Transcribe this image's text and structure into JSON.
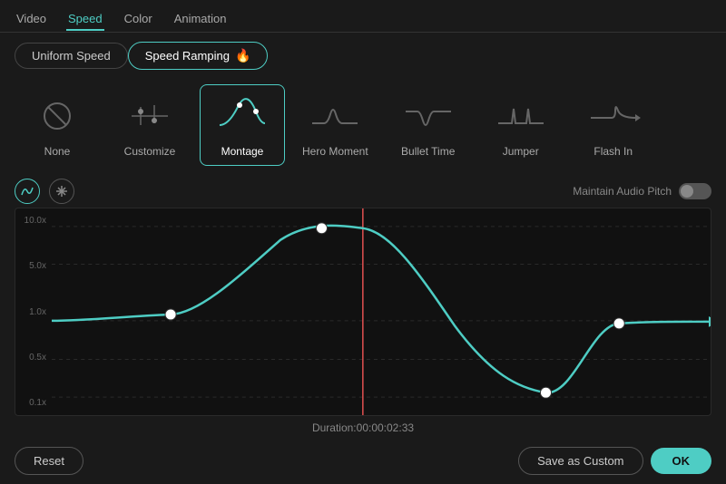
{
  "topNav": {
    "tabs": [
      {
        "id": "video",
        "label": "Video",
        "active": false
      },
      {
        "id": "speed",
        "label": "Speed",
        "active": true
      },
      {
        "id": "color",
        "label": "Color",
        "active": false
      },
      {
        "id": "animation",
        "label": "Animation",
        "active": false
      }
    ]
  },
  "speedToggle": {
    "uniformLabel": "Uniform Speed",
    "rampingLabel": "Speed Ramping",
    "activeTab": "ramping"
  },
  "presets": [
    {
      "id": "none",
      "label": "None",
      "selected": false
    },
    {
      "id": "customize",
      "label": "Customize",
      "selected": false
    },
    {
      "id": "montage",
      "label": "Montage",
      "selected": true
    },
    {
      "id": "hero-moment",
      "label": "Hero Moment",
      "selected": false
    },
    {
      "id": "bullet-time",
      "label": "Bullet Time",
      "selected": false
    },
    {
      "id": "jumper",
      "label": "Jumper",
      "selected": false
    },
    {
      "id": "flash-in",
      "label": "Flash In",
      "selected": false
    }
  ],
  "controls": {
    "curveBtn": "⟳",
    "freezeBtn": "✳",
    "maintainAudioLabel": "Maintain Audio Pitch"
  },
  "graph": {
    "yLabels": [
      "10.0x",
      "5.0x",
      "1.0x",
      "0.5x",
      "0.1x"
    ],
    "duration": "Duration:00:00:02:33"
  },
  "bottomBar": {
    "resetLabel": "Reset",
    "saveCustomLabel": "Save as Custom",
    "okLabel": "OK"
  }
}
